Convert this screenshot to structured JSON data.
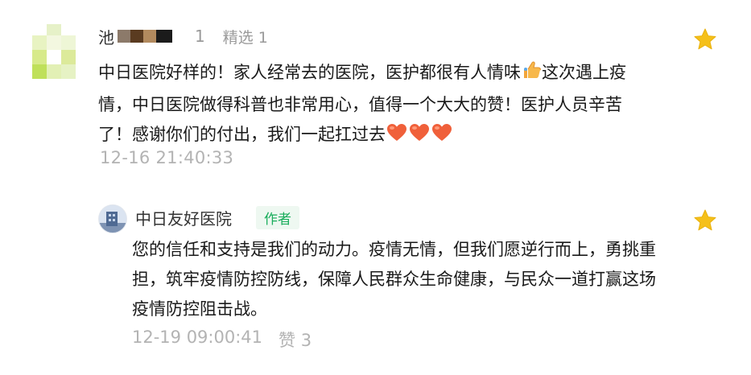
{
  "comment": {
    "name_visible": "池",
    "name_trail": "1",
    "featured": "精选 1",
    "text_part1": "中日医院好样的！家人经常去的医院，医护都很有人情味",
    "text_part2": "这次遇上疫情，中日医院做得科普也非常用心，值得一个大大的赞！医护人员辛苦了！感谢你们的付出，我们一起扛过去",
    "timestamp": "12-16 21:40:33",
    "icons": {
      "thumb": "thumbs-up-emoji",
      "heart": "orange-heart-emoji",
      "star": "star-icon"
    }
  },
  "reply": {
    "name": "中日友好医院",
    "badge": "作者",
    "text": "您的信任和支持是我们的动力。疫情无情，但我们愿逆行而上，勇挑重担，筑牢疫情防控防线，保障人民群众生命健康，与民众一道打赢这场疫情防控阻击战。",
    "timestamp": "12-19 09:00:41",
    "likes": "赞 3"
  },
  "colors": {
    "star": "#f5c01a",
    "badge_text": "#1aad5c",
    "meta": "#b3b3b3",
    "heart": "#f0603a"
  }
}
